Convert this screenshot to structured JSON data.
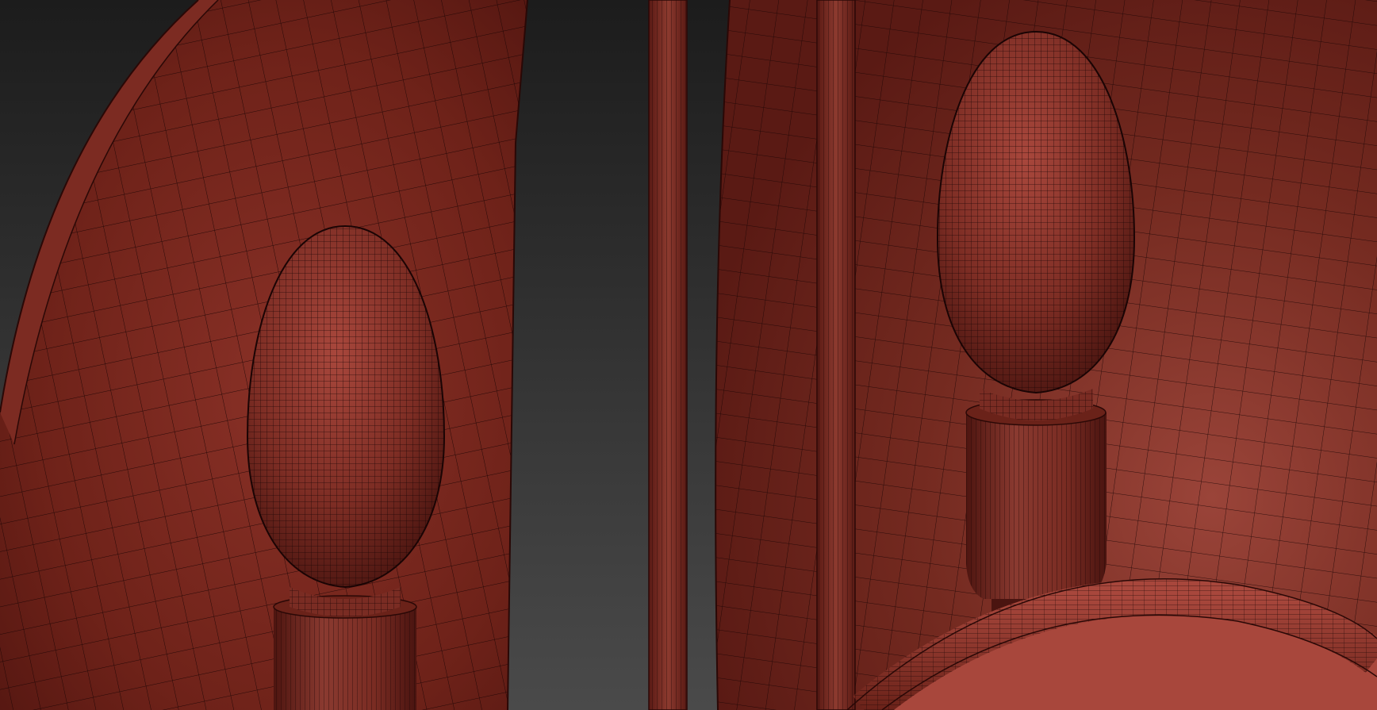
{
  "viewport": {
    "kind": "3d-wireframe-shaded-view",
    "background_colors": [
      "#1c1c1c",
      "#4a4a4a"
    ],
    "mesh_color": "#7a2a22",
    "mesh_highlight_color": "#a84a3e",
    "wire_color": "#1a0404"
  },
  "objects": [
    {
      "name": "left-shade-dome"
    },
    {
      "name": "right-shade-dome"
    },
    {
      "name": "left-candle-bulb"
    },
    {
      "name": "right-candle-bulb"
    },
    {
      "name": "center-rod-left"
    },
    {
      "name": "center-rod-right"
    },
    {
      "name": "bottom-ring"
    }
  ]
}
